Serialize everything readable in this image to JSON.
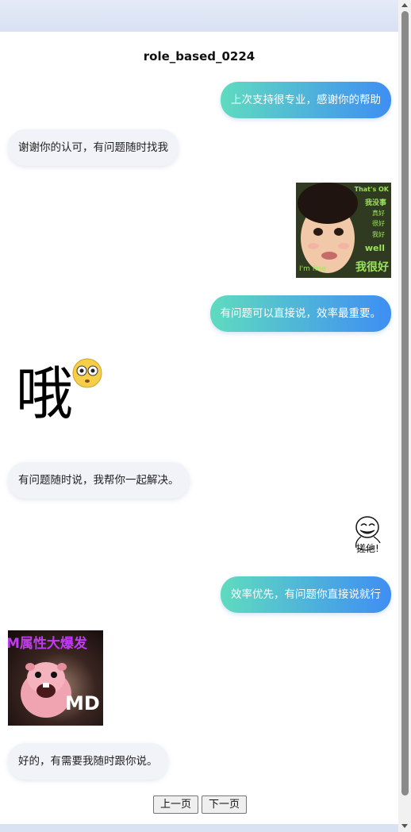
{
  "conversation": {
    "title": "role_based_0224",
    "messages": [
      {
        "role": "user",
        "type": "text",
        "text": "上次支持很专业，感谢你的帮助"
      },
      {
        "role": "bot",
        "type": "text",
        "text": "谢谢你的认可，有问题随时找我"
      },
      {
        "role": "user",
        "type": "sticker",
        "icon": "girl-sticker",
        "caption": [
          "That's OK",
          "我没事",
          "真好",
          "很好",
          "我好",
          "well",
          "我很好",
          "I'm fine"
        ]
      },
      {
        "role": "user",
        "type": "text",
        "text": "有问题可以直接说，效率最重要。"
      },
      {
        "role": "bot",
        "type": "sticker",
        "icon": "oh-emoji-sticker",
        "caption": "哦"
      },
      {
        "role": "bot",
        "type": "text",
        "text": "有问题随时说，我帮你一起解决。"
      },
      {
        "role": "user",
        "type": "sticker",
        "icon": "doodle-face-sticker",
        "caption": "搓他!"
      },
      {
        "role": "user",
        "type": "text",
        "text": "效率优先，有问题你直接说就行"
      },
      {
        "role": "bot",
        "type": "sticker",
        "icon": "loopy-beaver-sticker",
        "caption": [
          "M属性大爆发",
          "MD"
        ]
      },
      {
        "role": "bot",
        "type": "text",
        "text": "好的，有需要我随时跟你说。"
      }
    ]
  },
  "pagination": {
    "prev_label": "上一页",
    "next_label": "下一页"
  },
  "colors": {
    "user_bubble_start": "#5fdbbf",
    "user_bubble_end": "#3f8ef3",
    "bot_bubble": "#f1f3f8",
    "header_bar": "#dde6f5"
  }
}
